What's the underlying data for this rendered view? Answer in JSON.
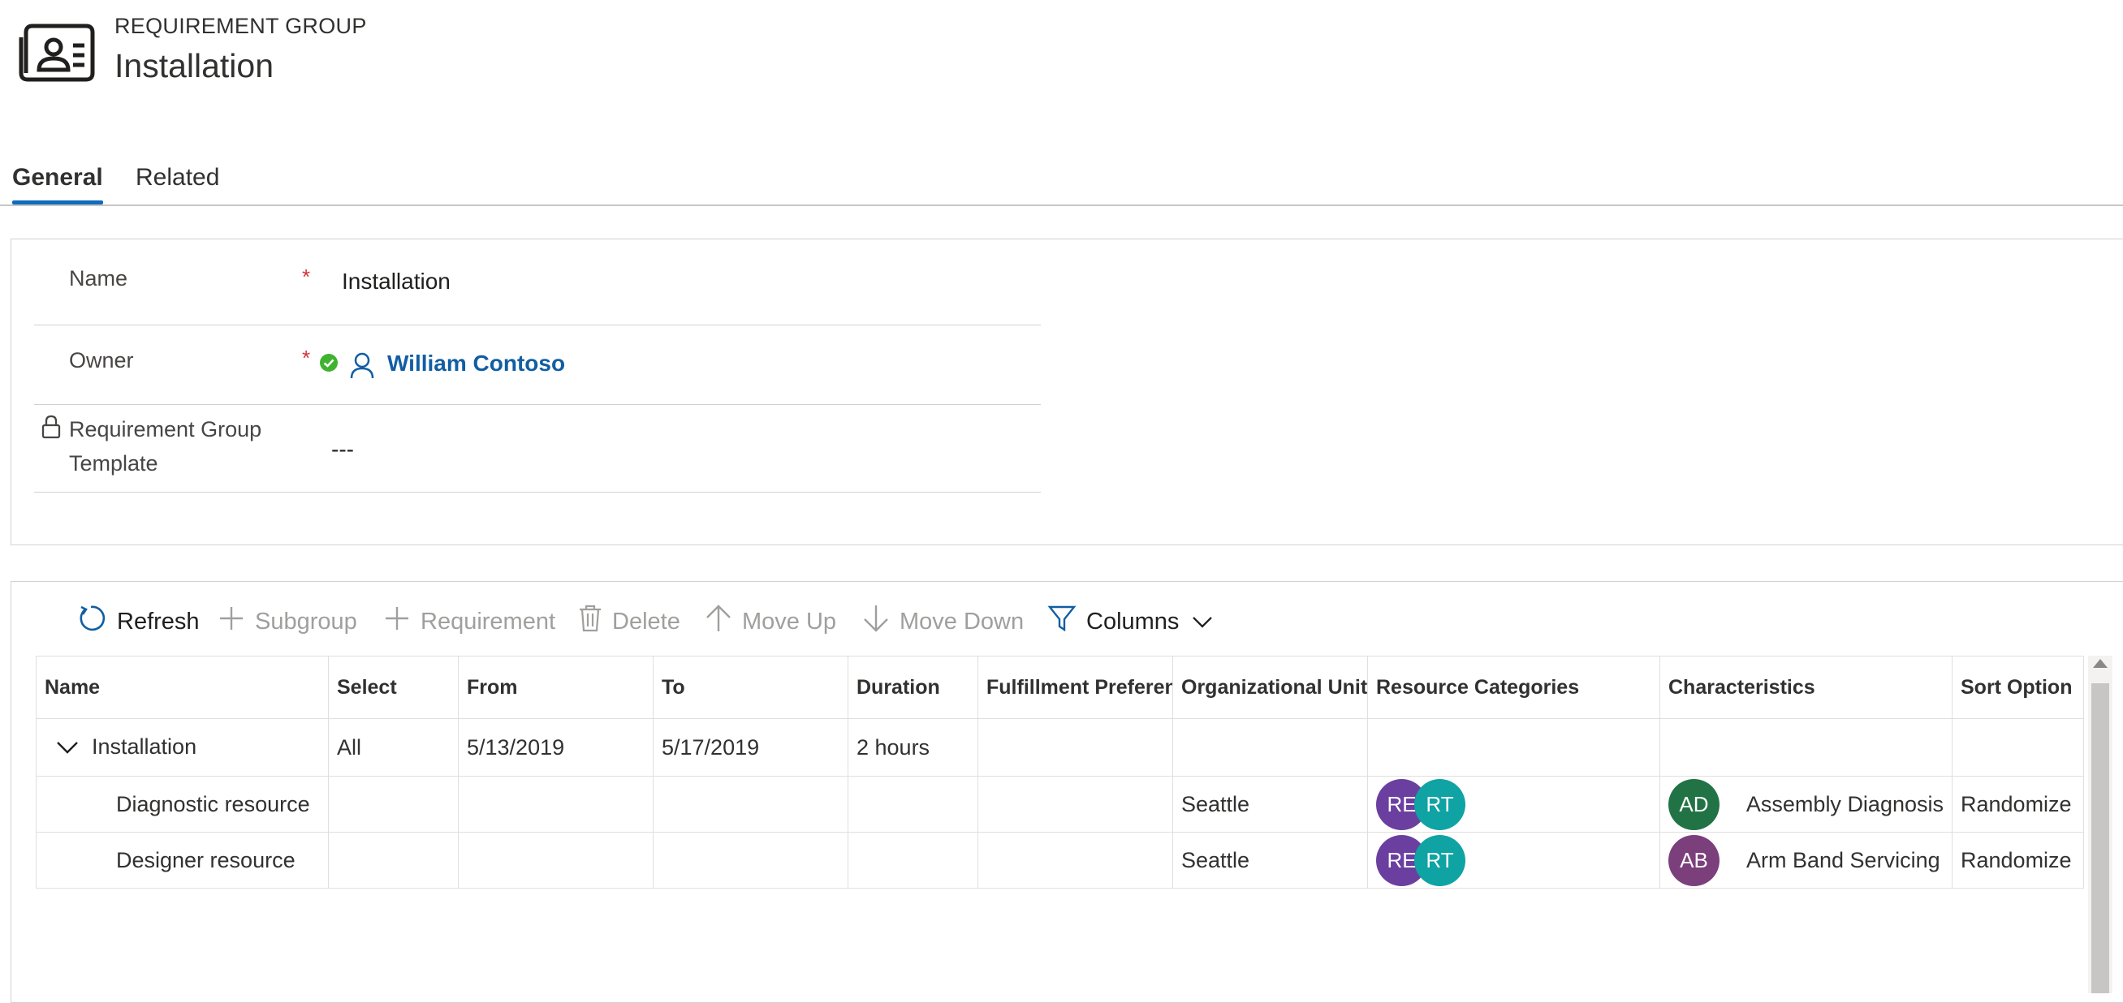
{
  "header": {
    "entity_type": "REQUIREMENT GROUP",
    "title": "Installation",
    "icon": "contact-card-icon"
  },
  "tabs": [
    {
      "label": "General",
      "selected": true
    },
    {
      "label": "Related",
      "selected": false
    }
  ],
  "form": {
    "name": {
      "label": "Name",
      "required": true,
      "value": "Installation"
    },
    "owner": {
      "label": "Owner",
      "required": true,
      "value": "William Contoso",
      "status_icon": "check-circle-icon",
      "icon": "person-icon"
    },
    "template": {
      "label_line1": "Requirement Group",
      "label_line2": "Template",
      "value": "---",
      "icon": "lock-icon"
    }
  },
  "commands": {
    "refresh": "Refresh",
    "subgroup": "Subgroup",
    "requirement": "Requirement",
    "delete": "Delete",
    "move_up": "Move Up",
    "move_down": "Move Down",
    "columns": "Columns"
  },
  "grid": {
    "columns": [
      "Name",
      "Select",
      "From",
      "To",
      "Duration",
      "Fulfillment Preference",
      "Organizational Unit",
      "Resource Categories",
      "Characteristics",
      "Sort Option"
    ],
    "group_row": {
      "name": "Installation",
      "select": "All",
      "from": "5/13/2019",
      "to": "5/17/2019",
      "duration": "2 hours"
    },
    "rows": [
      {
        "name": "Diagnostic resource",
        "org_unit": "Seattle",
        "categories": [
          {
            "initials": "RE",
            "color": "#6b3fa0"
          },
          {
            "initials": "RT",
            "color": "#0fa3a3"
          }
        ],
        "characteristic": {
          "initials": "AD",
          "color": "#217346",
          "name": "Assembly Diagnosis"
        },
        "sort_option": "Randomize"
      },
      {
        "name": "Designer resource",
        "org_unit": "Seattle",
        "categories": [
          {
            "initials": "RE",
            "color": "#6b3fa0"
          },
          {
            "initials": "RT",
            "color": "#0fa3a3"
          }
        ],
        "characteristic": {
          "initials": "AB",
          "color": "#7b3f7b",
          "name": "Arm Band Servicing"
        },
        "sort_option": "Randomize"
      }
    ]
  },
  "colors": {
    "accent": "#0f6cbd",
    "link": "#115ea3",
    "required": "#d13438",
    "success": "#3fb32f"
  }
}
